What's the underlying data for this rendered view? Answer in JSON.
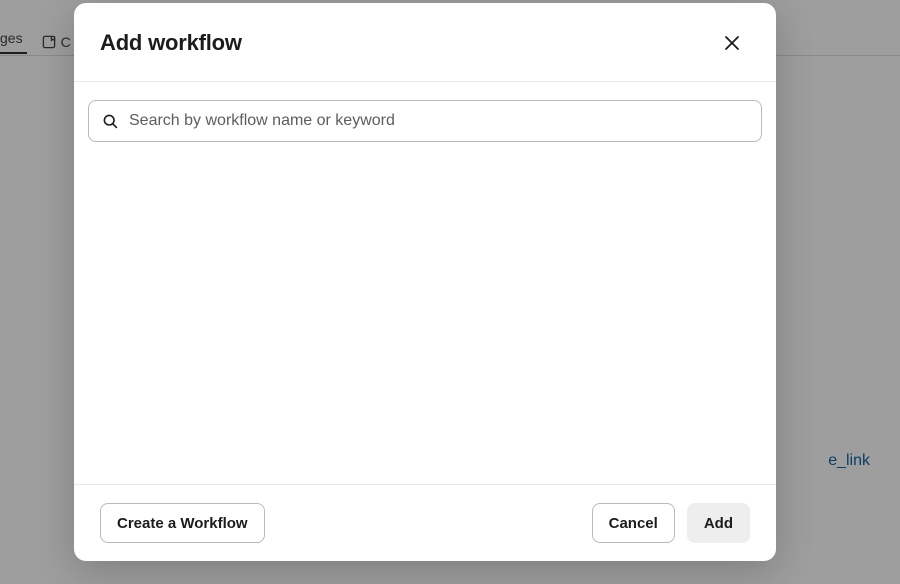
{
  "background": {
    "tab1": "ges",
    "tab2_partial": "C",
    "link_fragment": "e_link"
  },
  "modal": {
    "title": "Add workflow",
    "search": {
      "placeholder": "Search by workflow name or keyword",
      "value": ""
    },
    "buttons": {
      "create": "Create a Workflow",
      "cancel": "Cancel",
      "add": "Add"
    }
  }
}
